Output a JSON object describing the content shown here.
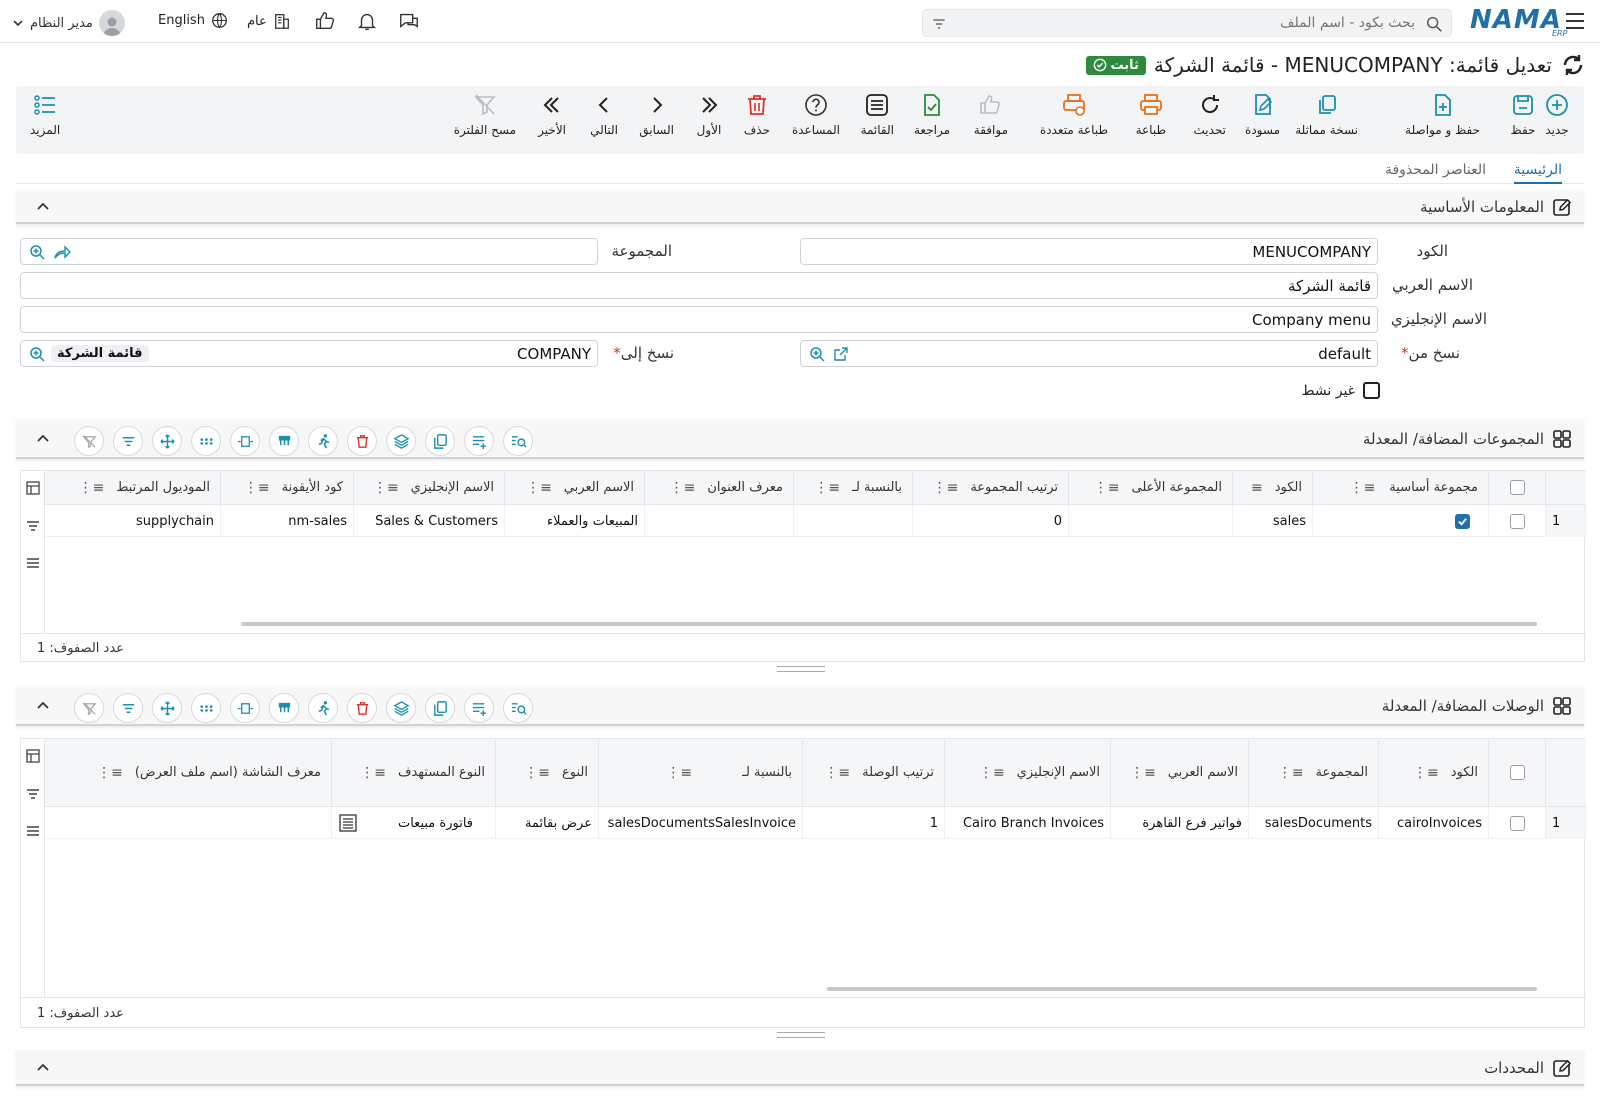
{
  "header": {
    "brand": "NAMA",
    "brand_sub": "ERP",
    "search_placeholder": "بحث بكود - اسم الملف",
    "user_name": "مدير النظام",
    "language": "English",
    "branch": "عام"
  },
  "page": {
    "title": "تعديل قائمة: MENUCOMPANY - قائمة الشركة",
    "status_badge": "ثابت"
  },
  "toolbar": {
    "new": "جديد",
    "save": "حفظ",
    "save_continue": "حفظ و مواصلة",
    "duplicate": "نسخة مماثلة",
    "draft": "مسودة",
    "refresh": "تحديث",
    "print": "طباعة",
    "multi_print": "طباعة متعددة",
    "approve": "موافقة",
    "review": "مراجعة",
    "list": "القائمة",
    "help": "المساعدة",
    "delete": "حذف",
    "first": "الأول",
    "prev": "السابق",
    "next": "التالي",
    "last": "الأخير",
    "clear_filter": "مسح الفلترة",
    "more": "المزيد"
  },
  "tabs": {
    "main": "الرئيسية",
    "deleted": "العناصر المحذوفة"
  },
  "basic_info": {
    "title": "المعلومات الأساسية",
    "code_label": "الكود",
    "code_value": "MENUCOMPANY",
    "group_label": "المجموعة",
    "group_value": "",
    "arabic_name_label": "الاسم العربي",
    "arabic_name_value": "قائمة الشركة",
    "english_name_label": "الاسم الإنجليزي",
    "english_name_value": "Company menu",
    "copy_from_label": "نسخ من",
    "copy_from_value": "default",
    "copy_to_label": "نسخ إلى",
    "copy_to_value": "COMPANY",
    "copy_to_tag": "قائمة الشركة",
    "inactive_label": "غير نشط"
  },
  "groups_section": {
    "title": "المجموعات المضافة/ المعدلة",
    "columns": [
      "مجموعة أساسية",
      "الكود",
      "المجموعة الأعلى",
      "ترتيب المجموعة",
      "بالنسبة لـ",
      "معرف العنوان",
      "الاسم العربي",
      "الاسم الإنجليزي",
      "كود الأيقونة",
      "الموديول المرتبط"
    ],
    "rows": [
      {
        "num": "1",
        "code": "sales",
        "parent": "",
        "order": "0",
        "for": "",
        "title_id": "",
        "arabic": "المبيعات والعملاء",
        "english": "Sales & Customers",
        "icon_code": "nm-sales",
        "module": "supplychain"
      }
    ],
    "row_count": "عدد الصفوف: 1"
  },
  "links_section": {
    "title": "الوصلات المضافة/ المعدلة",
    "columns": [
      "الكود",
      "المجموعة",
      "الاسم العربي",
      "الاسم الإنجليزي",
      "ترتيب الوصلة",
      "بالنسبة لـ",
      "النوع",
      "النوع المستهدف",
      "معرف الشاشة (اسم ملف العرض)"
    ],
    "rows": [
      {
        "num": "1",
        "code": "cairoInvoices",
        "group": "salesDocuments",
        "arabic": "فواتير فرع القاهرة",
        "english": "Cairo Branch Invoices",
        "order": "1",
        "for": "salesDocumentsSalesInvoice",
        "type": "عرض بقائمة",
        "target_type": "فاتورة مبيعات",
        "screen_id": ""
      }
    ],
    "row_count": "عدد الصفوف: 1"
  },
  "determinants_section": {
    "title": "المحددات"
  },
  "colors": {
    "brand": "#1f6fa8",
    "teal": "#1b8fb0",
    "green": "#2e8b3e",
    "orange": "#e8711a",
    "red": "#d9342b"
  }
}
